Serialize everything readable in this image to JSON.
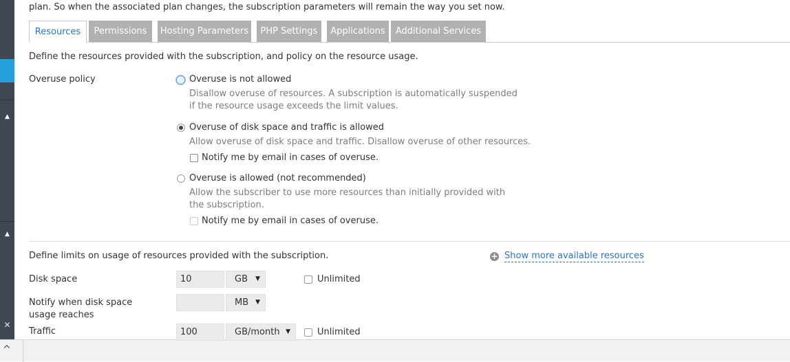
{
  "intro_text": "plan. So when the associated plan changes, the subscription parameters will remain the way you set now.",
  "tabs": [
    {
      "label": "Resources",
      "active": true
    },
    {
      "label": "Permissions",
      "active": false
    },
    {
      "label": "Hosting Parameters",
      "active": false
    },
    {
      "label": "PHP Settings",
      "active": false
    },
    {
      "label": "Applications",
      "active": false
    },
    {
      "label": "Additional Services",
      "active": false
    }
  ],
  "resources": {
    "heading": "Define the resources provided with the subscription, and policy on the resource usage.",
    "overuse_label": "Overuse policy",
    "options": [
      {
        "label": "Overuse is not allowed",
        "selected": false,
        "description": "Disallow overuse of resources. A subscription is automatically suspended if the resource usage exceeds the limit values."
      },
      {
        "label": "Overuse of disk space and traffic is allowed",
        "selected": true,
        "description": "Allow overuse of disk space and traffic. Disallow overuse of other resources.",
        "notify_label": "Notify me by email in cases of overuse."
      },
      {
        "label": "Overuse is allowed (not recommended)",
        "selected": false,
        "description": "Allow the subscriber to use more resources than initially provided with the subscription.",
        "notify_label": "Notify me by email in cases of overuse."
      }
    ]
  },
  "limits": {
    "heading": "Define limits on usage of resources provided with the subscription.",
    "show_more_link": "Show more available resources",
    "rows": [
      {
        "label": "Disk space",
        "value": "10",
        "unit": "GB",
        "unlimited_label": "Unlimited"
      },
      {
        "label": "Notify when disk space usage reaches",
        "value": "",
        "unit": "MB"
      },
      {
        "label": "Traffic",
        "value": "100",
        "unit": "GB/month",
        "unlimited_label": "Unlimited"
      }
    ]
  },
  "icons": {
    "collapse_1": "up-arrow-icon",
    "collapse_2": "up-arrow-icon",
    "close": "close-icon",
    "bottom": "chevron-up-icon",
    "add": "plus-circle-icon"
  },
  "colors": {
    "accent": "#25a0da",
    "link": "#2876c6",
    "sidebar": "#3d4852",
    "tab_inactive": "#b1b1b1"
  }
}
